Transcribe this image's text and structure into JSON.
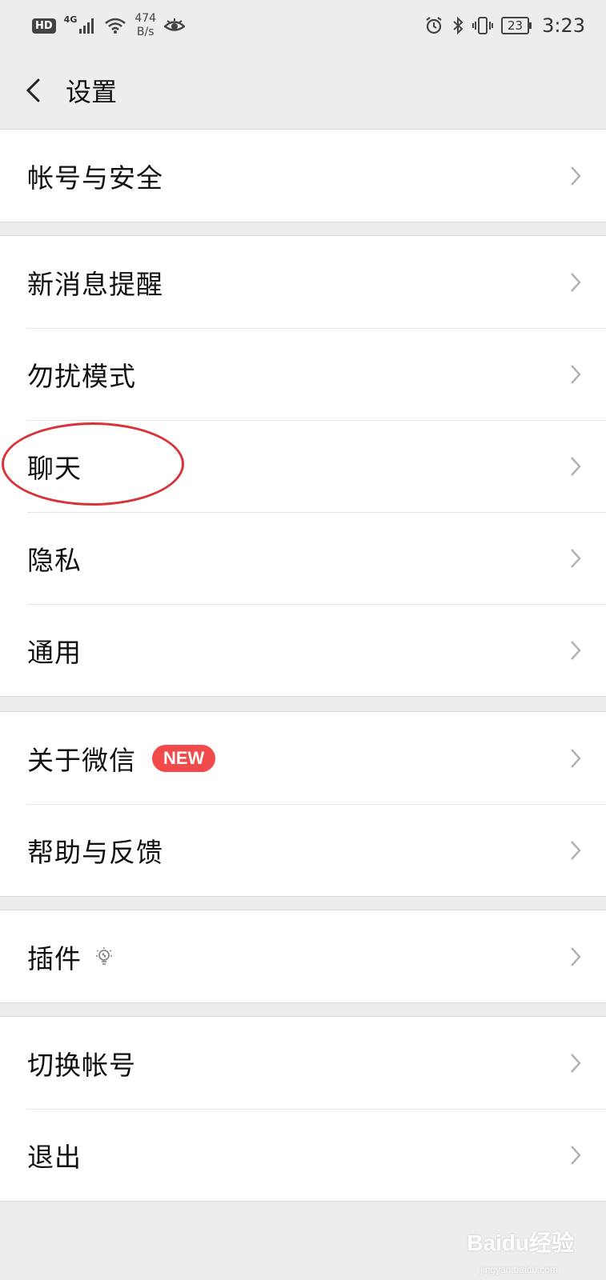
{
  "status_bar": {
    "hd": "HD",
    "network": "4G",
    "speed_value": "474",
    "speed_unit": "B/s",
    "battery": "23",
    "time": "3:23"
  },
  "header": {
    "title": "设置"
  },
  "groups": [
    {
      "items": [
        {
          "label": "帐号与安全"
        }
      ]
    },
    {
      "items": [
        {
          "label": "新消息提醒"
        },
        {
          "label": "勿扰模式"
        },
        {
          "label": "聊天"
        },
        {
          "label": "隐私"
        },
        {
          "label": "通用"
        }
      ]
    },
    {
      "items": [
        {
          "label": "关于微信",
          "badge": "NEW"
        },
        {
          "label": "帮助与反馈"
        }
      ]
    },
    {
      "items": [
        {
          "label": "插件"
        }
      ]
    },
    {
      "items": [
        {
          "label": "切换帐号"
        },
        {
          "label": "退出"
        }
      ]
    }
  ],
  "watermark": {
    "main": "Baidu经验",
    "sub": "jingyan.baidu.com"
  },
  "colors": {
    "background": "#ededed",
    "badge": "#f04a4a",
    "highlight_circle": "#d9333a"
  }
}
